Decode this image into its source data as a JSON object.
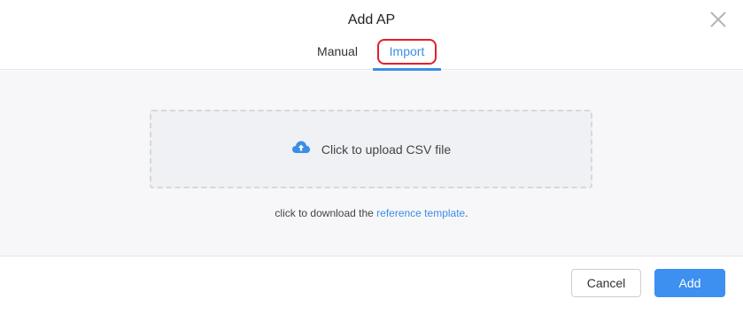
{
  "dialog": {
    "title": "Add AP",
    "close_icon": "close-icon"
  },
  "tabs": [
    {
      "label": "Manual",
      "active": false
    },
    {
      "label": "Import",
      "active": true
    }
  ],
  "upload": {
    "icon": "cloud-upload-icon",
    "label": "Click to upload CSV file"
  },
  "template": {
    "prefix": "click to download the ",
    "link": "reference template",
    "suffix": "."
  },
  "footer": {
    "cancel_label": "Cancel",
    "add_label": "Add"
  },
  "colors": {
    "accent": "#3a8ee6",
    "primary_button": "#3d8ff0",
    "highlight_annotation": "#e0202a"
  }
}
